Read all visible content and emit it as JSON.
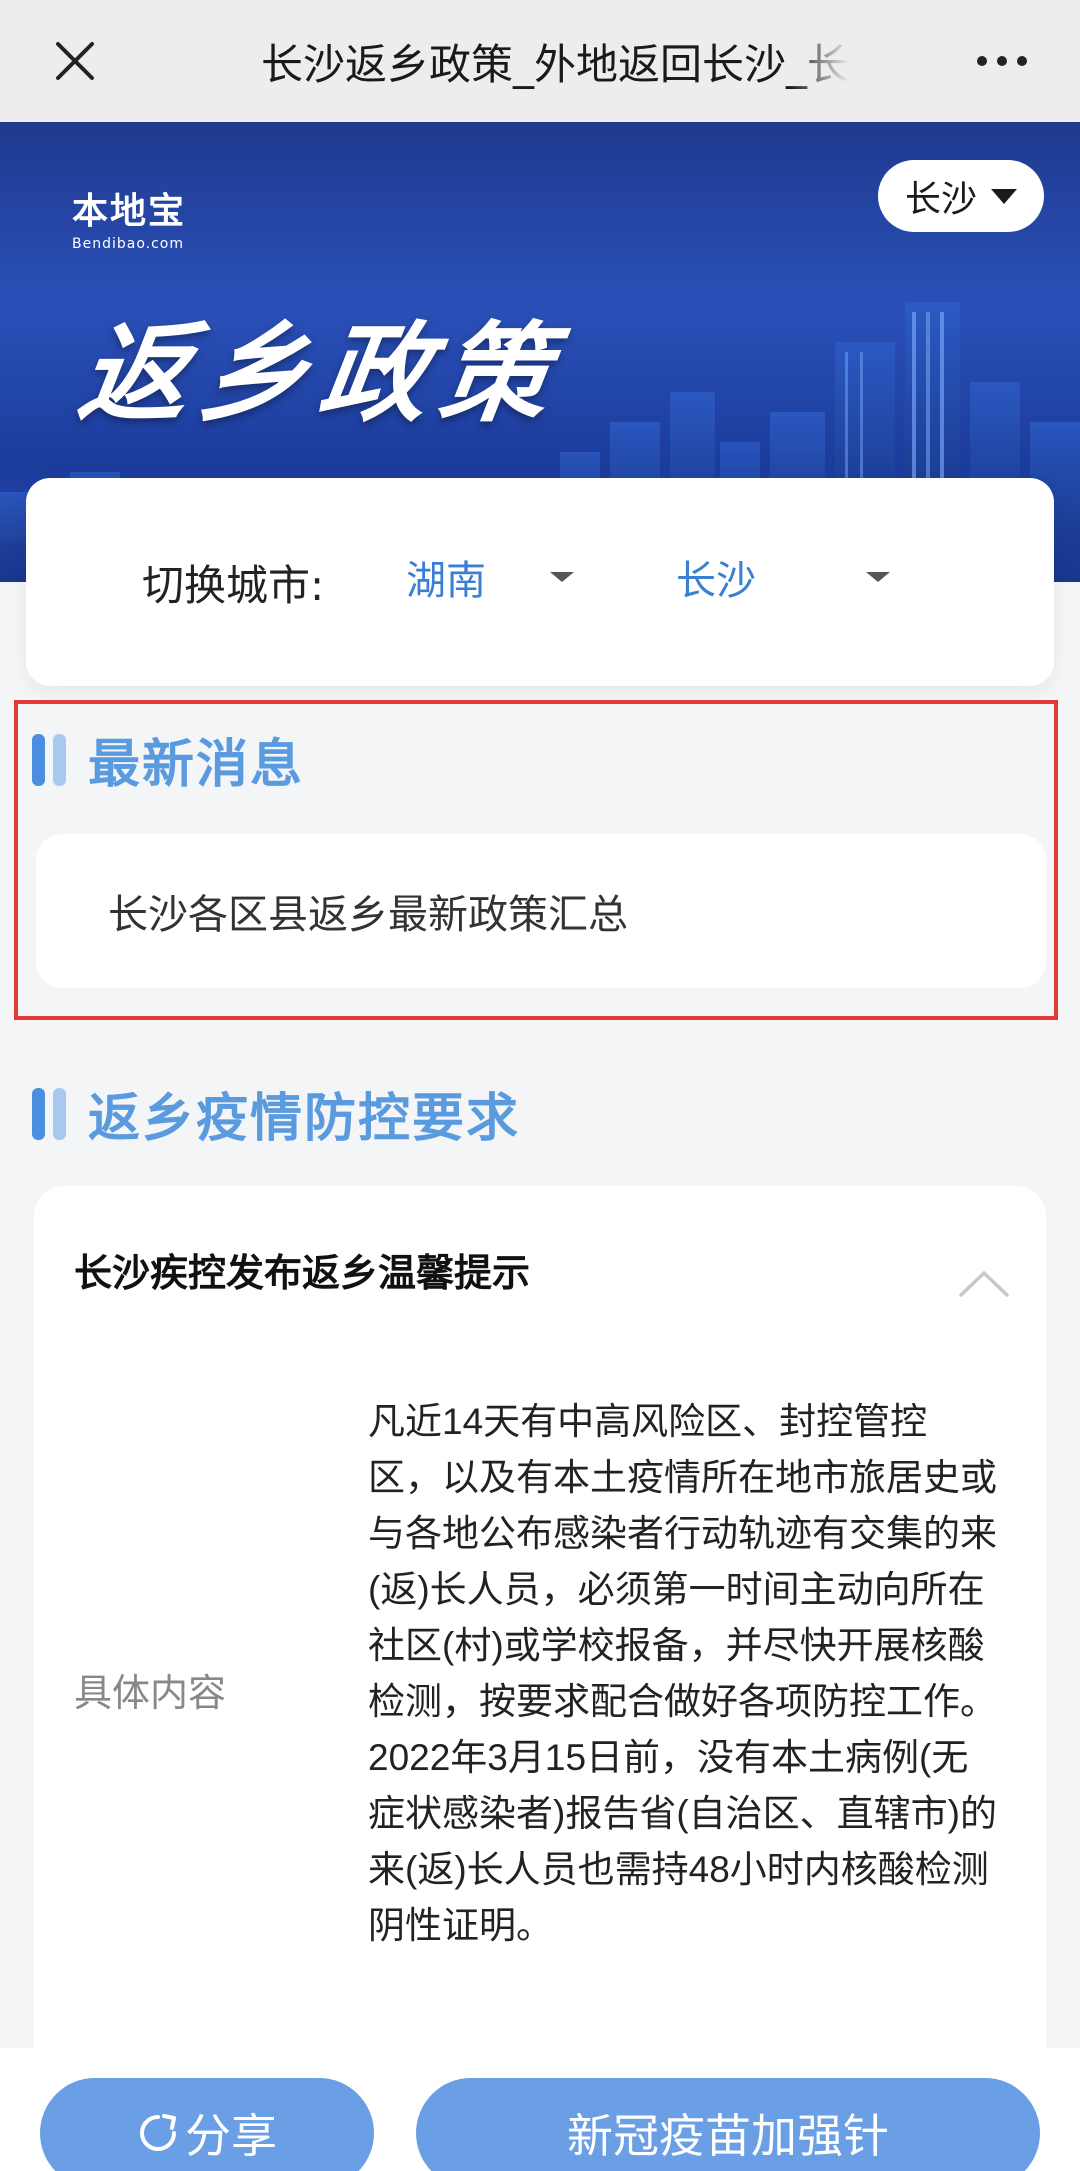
{
  "navbar": {
    "title": "长沙返乡政策_外地返回长沙_长"
  },
  "banner": {
    "logo_text": "本地宝",
    "logo_sub": "Bendibao.com",
    "title": "返乡政策",
    "city_pill": "长沙"
  },
  "switch_city": {
    "label": "切换城市:",
    "province": "湖南",
    "city": "长沙"
  },
  "latest": {
    "title": "最新消息",
    "item": "长沙各区县返乡最新政策汇总"
  },
  "requirements": {
    "title": "返乡疫情防控要求",
    "card_title": "长沙疾控发布返乡温馨提示",
    "detail_label": "具体内容",
    "detail_text": "凡近14天有中高风险区、封控管控区，以及有本土疫情所在地市旅居史或与各地公布感染者行动轨迹有交集的来(返)长人员，必须第一时间主动向所在社区(村)或学校报备，并尽快开展核酸检测，按要求配合做好各项防控工作。 2022年3月15日前，没有本土病例(无症状感染者)报告省(自治区、直辖市)的来(返)长人员也需持48小时内核酸检测阴性证明。"
  },
  "bottom": {
    "share_label": "分享",
    "booster_label": "新冠疫苗加强针"
  },
  "colors": {
    "accent": "#5a9be0",
    "button": "#6a9fe6",
    "highlight": "#e53935",
    "banner": "#2a50b8"
  }
}
